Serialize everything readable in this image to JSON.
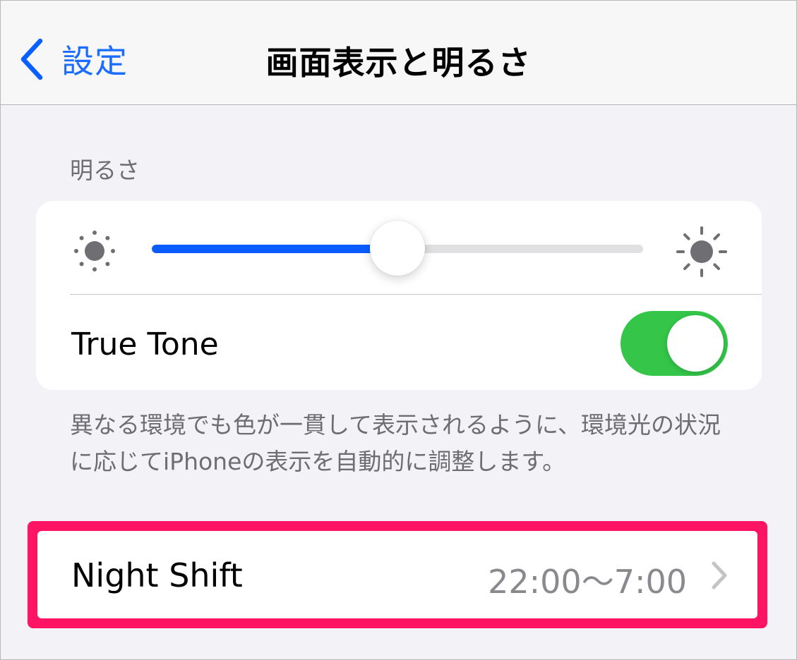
{
  "nav": {
    "back_label": "設定",
    "title": "画面表示と明るさ"
  },
  "brightness": {
    "header": "明るさ",
    "slider_level": 0.5,
    "true_tone_label": "True Tone",
    "true_tone_on": true,
    "footer": "異なる環境でも色が一貫して表示されるように、環境光の状況に応じてiPhoneの表示を自動的に調整します。"
  },
  "night_shift": {
    "label": "Night Shift",
    "value": "22:00〜7:00"
  },
  "colors": {
    "accent": "#0b5cff",
    "toggle_on": "#34c549",
    "highlight": "#ff1464"
  },
  "icons": {
    "back": "chevron-left-icon",
    "brightness_low": "sun-small-icon",
    "brightness_high": "sun-large-icon",
    "disclosure": "chevron-right-icon"
  }
}
